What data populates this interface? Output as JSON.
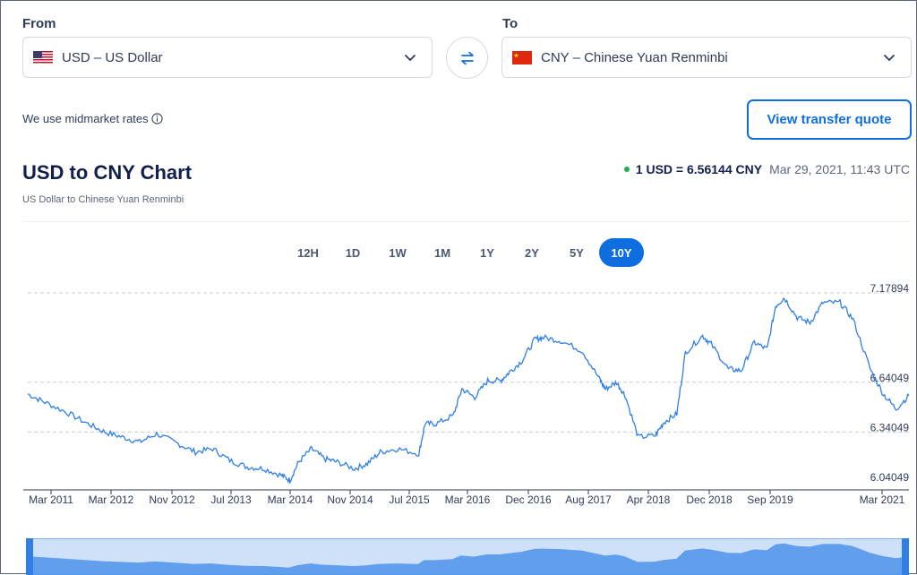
{
  "from": {
    "label": "From",
    "currency": "USD – US Dollar"
  },
  "to": {
    "label": "To",
    "currency": "CNY – Chinese Yuan Renminbi"
  },
  "midmarket_note": "We use midmarket rates",
  "quote_button": "View transfer quote",
  "chart_title": "USD to CNY Chart",
  "chart_subtitle": "US Dollar to Chinese Yuan Renminbi",
  "current_rate": {
    "value": "1 USD = 6.56144 CNY",
    "timestamp": "Mar 29, 2021, 11:43 UTC",
    "status_color": "#21b04b"
  },
  "ranges": [
    "12H",
    "1D",
    "1W",
    "1M",
    "1Y",
    "2Y",
    "5Y",
    "10Y"
  ],
  "active_range": "10Y",
  "colors": {
    "accent": "#0e6ee0",
    "line": "#2f7fe6",
    "title": "#131f4b"
  },
  "chart_data": {
    "type": "line",
    "title": "USD to CNY Chart",
    "subtitle": "US Dollar to Chinese Yuan Renminbi",
    "x_tick_labels": [
      "Mar 2011",
      "Mar 2012",
      "Nov 2012",
      "Jul 2013",
      "Mar 2014",
      "Nov 2014",
      "Jul 2015",
      "Mar 2016",
      "Dec 2016",
      "Aug 2017",
      "Apr 2018",
      "Dec 2018",
      "Sep 2019",
      "Mar 2021"
    ],
    "y_tick_labels": [
      "7.17894",
      "6.64049",
      "6.34049",
      "6.04049"
    ],
    "ylim": [
      6.04049,
      7.17894
    ],
    "xlim": [
      2011.0,
      2021.25
    ],
    "grid": "horizontal dashed",
    "series": [
      {
        "x": [
          2011.0,
          2011.2,
          2011.45,
          2011.7,
          2011.9,
          2012.1,
          2012.3,
          2012.5,
          2012.75,
          2012.95,
          2013.15,
          2013.35,
          2013.55,
          2013.75,
          2013.95,
          2014.05,
          2014.15,
          2014.3,
          2014.45,
          2014.6,
          2014.8,
          2014.95,
          2015.1,
          2015.3,
          2015.55,
          2015.62,
          2015.75,
          2015.95,
          2016.05,
          2016.2,
          2016.35,
          2016.5,
          2016.6,
          2016.75,
          2016.9,
          2017.0,
          2017.2,
          2017.45,
          2017.65,
          2017.72,
          2017.85,
          2017.95,
          2018.1,
          2018.3,
          2018.4,
          2018.55,
          2018.65,
          2018.85,
          2018.95,
          2019.15,
          2019.3,
          2019.45,
          2019.6,
          2019.7,
          2019.8,
          2019.95,
          2020.1,
          2020.25,
          2020.45,
          2020.6,
          2020.8,
          2020.95,
          2021.1,
          2021.25
        ],
        "y": [
          6.57,
          6.52,
          6.46,
          6.39,
          6.34,
          6.31,
          6.28,
          6.33,
          6.27,
          6.22,
          6.24,
          6.17,
          6.13,
          6.12,
          6.08,
          6.05,
          6.16,
          6.24,
          6.18,
          6.16,
          6.12,
          6.15,
          6.22,
          6.24,
          6.21,
          6.39,
          6.39,
          6.44,
          6.6,
          6.55,
          6.65,
          6.65,
          6.7,
          6.77,
          6.9,
          6.91,
          6.89,
          6.83,
          6.66,
          6.6,
          6.64,
          6.56,
          6.31,
          6.32,
          6.4,
          6.45,
          6.82,
          6.92,
          6.87,
          6.72,
          6.71,
          6.88,
          6.84,
          7.1,
          7.15,
          7.03,
          7.0,
          7.12,
          7.12,
          7.02,
          6.72,
          6.57,
          6.48,
          6.56
        ]
      }
    ]
  }
}
